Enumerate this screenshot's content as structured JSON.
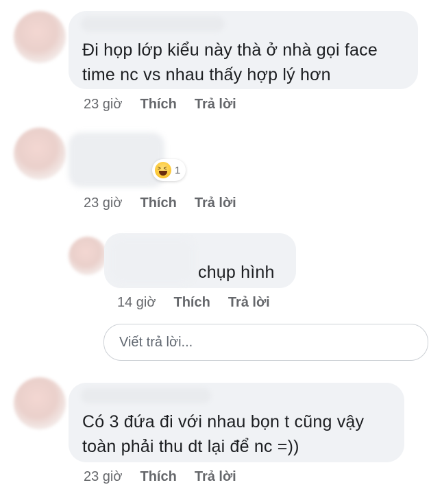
{
  "comments": [
    {
      "text_lines": [
        "Đi họp lớp kiểu này thà ở nhà gọi face",
        "time nc vs nhau thấy hợp lý hơn"
      ],
      "time": "23 giờ",
      "like_label": "Thích",
      "reply_label": "Trả lời"
    },
    {
      "text_lines": [],
      "reaction": {
        "icon": "haha-emoji-icon",
        "count": "1"
      },
      "time": "23 giờ",
      "like_label": "Thích",
      "reply_label": "Trả lời"
    },
    {
      "text_lines": [
        "chụp hình"
      ],
      "time": "14 giờ",
      "like_label": "Thích",
      "reply_label": "Trả lời",
      "is_reply": true
    },
    {
      "text_lines": [
        "Có 3 đứa đi với nhau bọn t cũng vậy",
        "toàn phải thu dt lại để nc =))"
      ],
      "time": "23 giờ",
      "like_label": "Thích",
      "reply_label": "Trả lời"
    }
  ],
  "reply_input": {
    "placeholder": "Viết trả lời..."
  },
  "colors": {
    "bubble": "#f0f2f5",
    "meta": "#65676b",
    "text": "#1c1e21"
  }
}
